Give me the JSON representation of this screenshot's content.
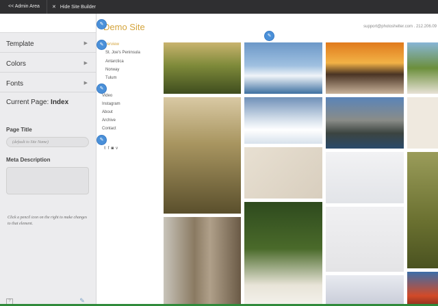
{
  "topbar": {
    "admin_label": "<< Admin Area",
    "hide_label": "Hide Site Builder"
  },
  "sidebar": {
    "items": [
      {
        "label": "Template"
      },
      {
        "label": "Colors"
      },
      {
        "label": "Fonts"
      }
    ],
    "current_page_prefix": "Current Page:",
    "current_page_name": "Index",
    "page_title_label": "Page Title",
    "page_title_placeholder": "(default to Site Name)",
    "meta_label": "Meta Description",
    "hint": "Click a pencil icon on the right to make changes to that element."
  },
  "site": {
    "logo": "Demo Site",
    "contact": "support@photoshelter.com . 212.206.09",
    "nav_primary": [
      {
        "label": "Overview",
        "active": true
      },
      {
        "label": "St. Joe's Peninsula"
      },
      {
        "label": "Antarctica"
      },
      {
        "label": "Norway"
      },
      {
        "label": "Tulum"
      }
    ],
    "nav_secondary": [
      {
        "label": "Video"
      },
      {
        "label": "Instagram"
      },
      {
        "label": "About"
      },
      {
        "label": "Archive"
      },
      {
        "label": "Contact"
      }
    ],
    "social": [
      "twitter-icon",
      "facebook-icon",
      "instagram-icon",
      "vimeo-icon"
    ],
    "photos": [
      "grass-sunset-photo",
      "snowy-mountains-photo",
      "desert-sunset-photo",
      "beach-trees-photo",
      "backlit-grass-photo",
      "antarctic-camp-photo",
      "lofoten-village-photo",
      "sand-texture-photo",
      "sand-closeup-photo",
      "snowy-field-photo",
      "field-grass-photo",
      "tree-bark-photo",
      "wine-glass-photo",
      "seal-on-snow-photo",
      "bird-on-snow-photo",
      "red-cabin-photo"
    ]
  },
  "colors": {
    "accent": "#d4a43c",
    "pin": "#4a90d9",
    "topbar": "#2f2f31"
  }
}
